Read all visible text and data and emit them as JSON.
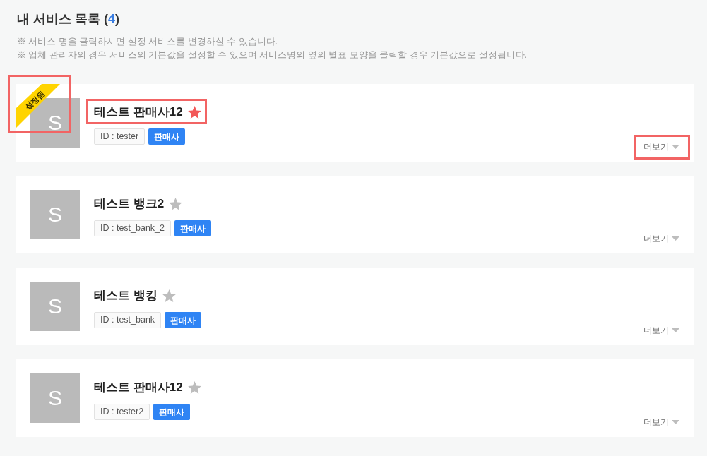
{
  "heading": {
    "text": "내 서비스 목록 (",
    "count": "4",
    "suffix": ")"
  },
  "notes": [
    "※ 서비스 명을 클릭하시면 설정 서비스를 변경하실 수 있습니다.",
    "※ 업체 관리자의 경우 서비스의 기본값을 설정할 수 있으며 서비스명의 옆의 별표 모양을 클릭할 경우 기본값으로 설정됩니다."
  ],
  "services": [
    {
      "avatar": "S",
      "name": "테스트 판매사12",
      "default": true,
      "name_highlighted": true,
      "id_label": "ID : tester",
      "role": "판매사",
      "more": "더보기",
      "more_highlighted": true,
      "ribbon": {
        "label": "설정됨",
        "highlighted": true
      }
    },
    {
      "avatar": "S",
      "name": "테스트 뱅크2",
      "default": false,
      "name_highlighted": false,
      "id_label": "ID : test_bank_2",
      "role": "판매사",
      "more": "더보기",
      "more_highlighted": false
    },
    {
      "avatar": "S",
      "name": "테스트 뱅킹",
      "default": false,
      "name_highlighted": false,
      "id_label": "ID : test_bank",
      "role": "판매사",
      "more": "더보기",
      "more_highlighted": false
    },
    {
      "avatar": "S",
      "name": "테스트 판매사12",
      "default": false,
      "name_highlighted": false,
      "id_label": "ID : tester2",
      "role": "판매사",
      "more": "더보기",
      "more_highlighted": false
    }
  ]
}
